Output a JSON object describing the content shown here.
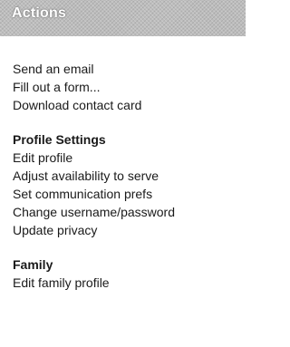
{
  "header": {
    "title": "Actions"
  },
  "actions": {
    "items": [
      {
        "label": "Send an email"
      },
      {
        "label": "Fill out a form..."
      },
      {
        "label": "Download contact card"
      }
    ]
  },
  "profile_settings": {
    "heading": "Profile Settings",
    "items": [
      {
        "label": "Edit profile"
      },
      {
        "label": "Adjust availability to serve"
      },
      {
        "label": "Set communication prefs"
      },
      {
        "label": "Change username/password"
      },
      {
        "label": "Update privacy"
      }
    ]
  },
  "family": {
    "heading": "Family",
    "items": [
      {
        "label": "Edit family profile"
      }
    ]
  }
}
